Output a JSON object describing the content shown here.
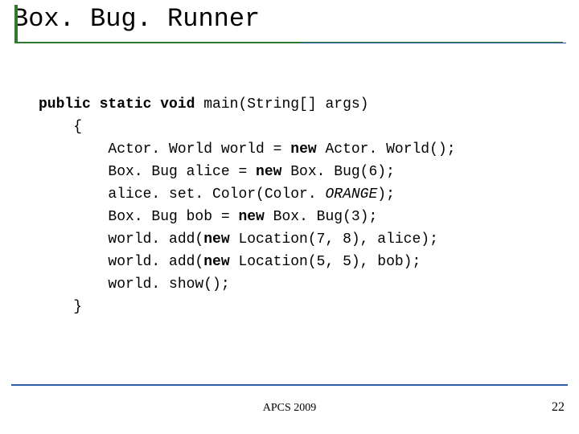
{
  "title": "Box. Bug. Runner",
  "code": {
    "sig_pre": "public static void",
    "sig_post": " main(String[] args)",
    "open": "    {",
    "l1a": "        Actor. World world = ",
    "l1b": "new",
    "l1c": " Actor. World();",
    "l2a": "        Box. Bug alice = ",
    "l2b": "new",
    "l2c": " Box. Bug(6);",
    "l3a": "        alice. set. Color(Color. ",
    "l3b": "ORANGE",
    "l3c": ");",
    "l4a": "        Box. Bug bob = ",
    "l4b": "new",
    "l4c": " Box. Bug(3);",
    "l5a": "        world. add(",
    "l5b": "new",
    "l5c": " Location(7, 8), alice);",
    "l6a": "        world. add(",
    "l6b": "new",
    "l6c": " Location(5, 5), bob);",
    "l7": "        world. show();",
    "close": "    }"
  },
  "footer": "APCS 2009",
  "page": "22"
}
